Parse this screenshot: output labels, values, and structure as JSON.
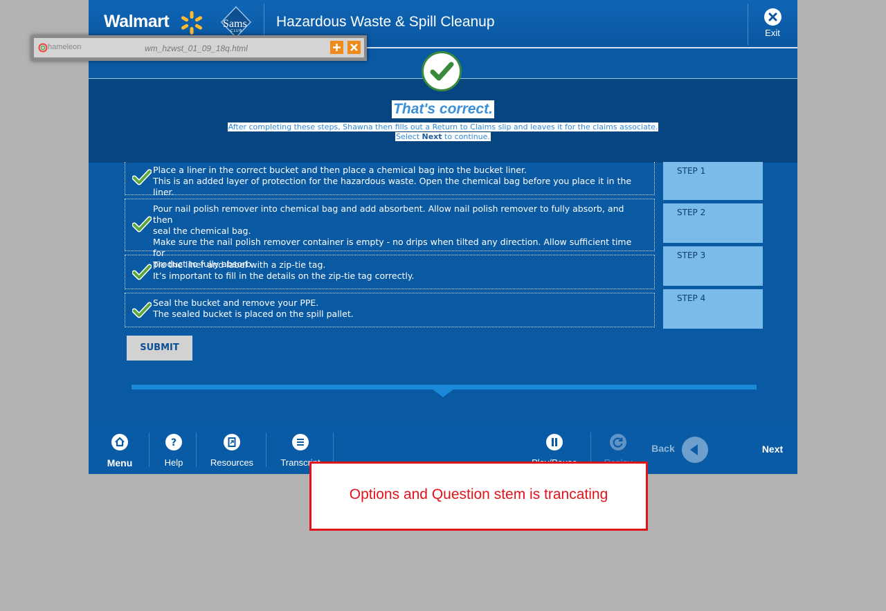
{
  "header": {
    "brand": "Walmart",
    "partner_brand": "Sams",
    "partner_brand_sub": "CLUB",
    "course_title": "Hazardous Waste & Spill Cleanup",
    "exit_label": "Exit"
  },
  "feedback": {
    "title": "That's correct.",
    "line1": "After completing these steps, Shawna then fills out a Return to Claims slip and leaves it for the claims associate.",
    "line2_prefix": "Select ",
    "line2_bold": "Next",
    "line2_suffix": " to continue."
  },
  "options": [
    {
      "line1": "Place a liner in the correct bucket and then place a chemical bag into the bucket liner.",
      "line2": "This is an added layer of protection for the hazardous waste.  Open the chemical bag before you place it in the liner."
    },
    {
      "line1": "Pour nail polish remover into chemical bag and add absorbent.  Allow nail polish remover to fully absorb, and then",
      "line2": "seal the chemical bag.",
      "line3": "Make sure the nail polish remover container is empty - no drips when tilted any direction.  Allow sufficient time for",
      "line4": "product to fully absorb."
    },
    {
      "line1": "Tie the liner and label with a zip-tie tag.",
      "line2": "It’s important to fill in the details on the zip-tie tag correctly."
    },
    {
      "line1": "Seal the bucket and remove your PPE.",
      "line2": "The sealed bucket is placed on the spill pallet."
    }
  ],
  "steps": [
    "STEP 1",
    "STEP 2",
    "STEP 3",
    "STEP 4"
  ],
  "submit_label": "SUBMIT",
  "footer": {
    "menu": "Menu",
    "help": "Help",
    "resources": "Resources",
    "transcript": "Transcript",
    "play_pause": "Play/Pause",
    "replay": "Replay",
    "back": "Back",
    "next": "Next"
  },
  "chameleon": {
    "logo": "hameleon",
    "file": "wm_hzwst_01_09_18q.html"
  },
  "annotation": "Options and Question stem is trancating",
  "colors": {
    "background": "#b3b3b3",
    "app": "#0a5aa3",
    "feedback_bg": "#074581",
    "step_box": "#7bbbea",
    "check_green": "#3a8a3d",
    "annotation_red": "#e2121a"
  }
}
